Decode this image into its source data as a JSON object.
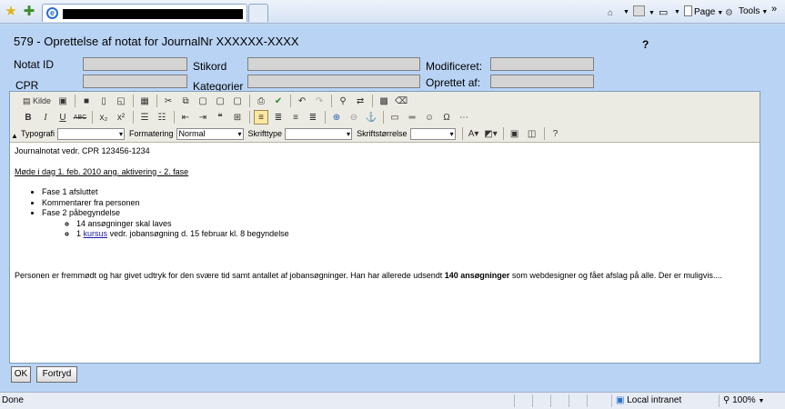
{
  "browser": {
    "commands": {
      "page": "Page",
      "tools": "Tools",
      "chevron": "»"
    }
  },
  "form": {
    "title": "579 - Oprettelse af notat for JournalNr XXXXXX-XXXX",
    "help": "?",
    "labels": {
      "notat_id": "Notat ID",
      "stikord": "Stikord",
      "modificeret": "Modificeret:",
      "cpr": "CPR",
      "kategorier": "Kategorier",
      "oprettet_af": "Oprettet af:"
    }
  },
  "toolbar": {
    "source_label": "Kilde",
    "typografi_label": "Typografi",
    "formatering_label": "Formatering",
    "formatering_value": "Normal",
    "skrifttype_label": "Skrifttype",
    "skriftstorrelse_label": "Skriftstørrelse",
    "bold": "B",
    "italic": "I",
    "underline": "U",
    "strike": "ABC"
  },
  "content": {
    "line1": "Journalnotat vedr. CPR 123456-1234",
    "line2": "Møde i dag 1. feb. 2010 ang. aktivering - 2. fase",
    "bullets": [
      "Fase 1 afsluttet",
      "Kommentarer fra personen",
      "Fase 2 påbegyndelse"
    ],
    "sub1": "14 ansøgninger skal laves",
    "sub2_prefix": "1",
    "sub2_link": "kursus",
    "sub2_suffix": "vedr. jobansøgning d. 15 februar kl. 8 begyndelse",
    "para_before": "Personen er fremmødt og har givet udtryk for den svære tid samt antallet af jobansøgninger. Han har allerede udsendt",
    "para_bold": "140 ansøgninger",
    "para_after": "som webdesigner og fået afslag på alle. Der er muligvis...."
  },
  "buttons": {
    "ok": "OK",
    "cancel": "Fortryd"
  },
  "status": {
    "done": "Done",
    "zone": "Local intranet",
    "zoom": "100%"
  }
}
